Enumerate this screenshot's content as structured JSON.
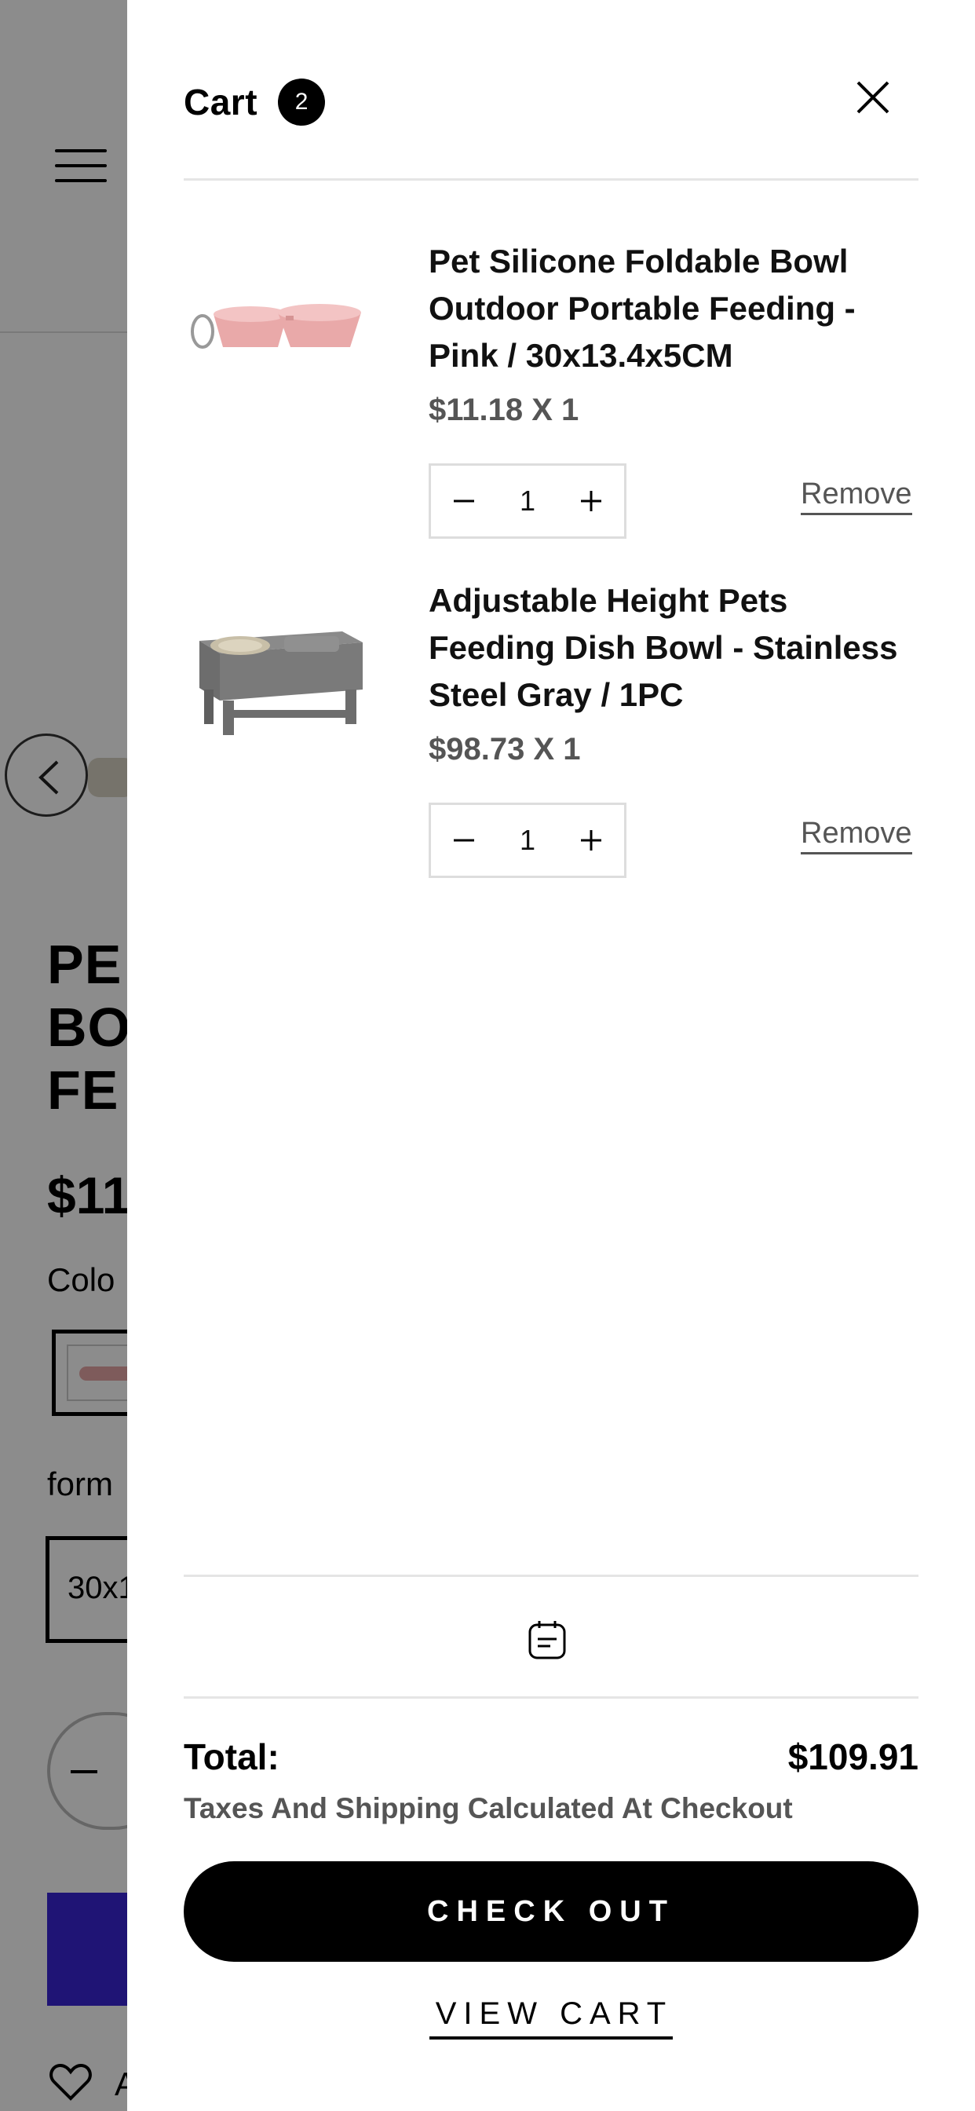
{
  "background_page": {
    "title_lines": [
      "PE",
      "BO",
      "FE"
    ],
    "price": "$11.",
    "color_label": "Colo",
    "format_label": "form",
    "format_value": "30x1",
    "qty_minus": "–",
    "wishlist_text": "A"
  },
  "cart": {
    "title": "Cart",
    "count": "2",
    "items": [
      {
        "name": "Pet Silicone Foldable Bowl Outdoor Portable Feeding - Pink / 30x13.4x5CM",
        "price": "$11.18 X 1",
        "quantity": "1",
        "remove_label": "Remove"
      },
      {
        "name": "Adjustable Height Pets Feeding Dish Bowl - Stainless Steel Gray / 1PC",
        "price": "$98.73 X 1",
        "quantity": "1",
        "remove_label": "Remove"
      }
    ],
    "total_label": "Total:",
    "total_value": "$109.91",
    "tax_note": "Taxes And Shipping Calculated At Checkout",
    "checkout_label": "CHECK OUT",
    "view_cart_label": "VIEW CART"
  },
  "colors": {
    "overlay": "rgba(0,0,0,0.45)",
    "checkout_bg": "#000000",
    "add_to_cart_bg": "#3a26d6",
    "muted_text": "#555555"
  },
  "icons": {
    "menu": "hamburger-icon",
    "prev": "chevron-left-icon",
    "close": "close-icon",
    "minus": "minus-icon",
    "plus": "plus-icon",
    "note": "note-icon",
    "heart": "heart-icon"
  }
}
